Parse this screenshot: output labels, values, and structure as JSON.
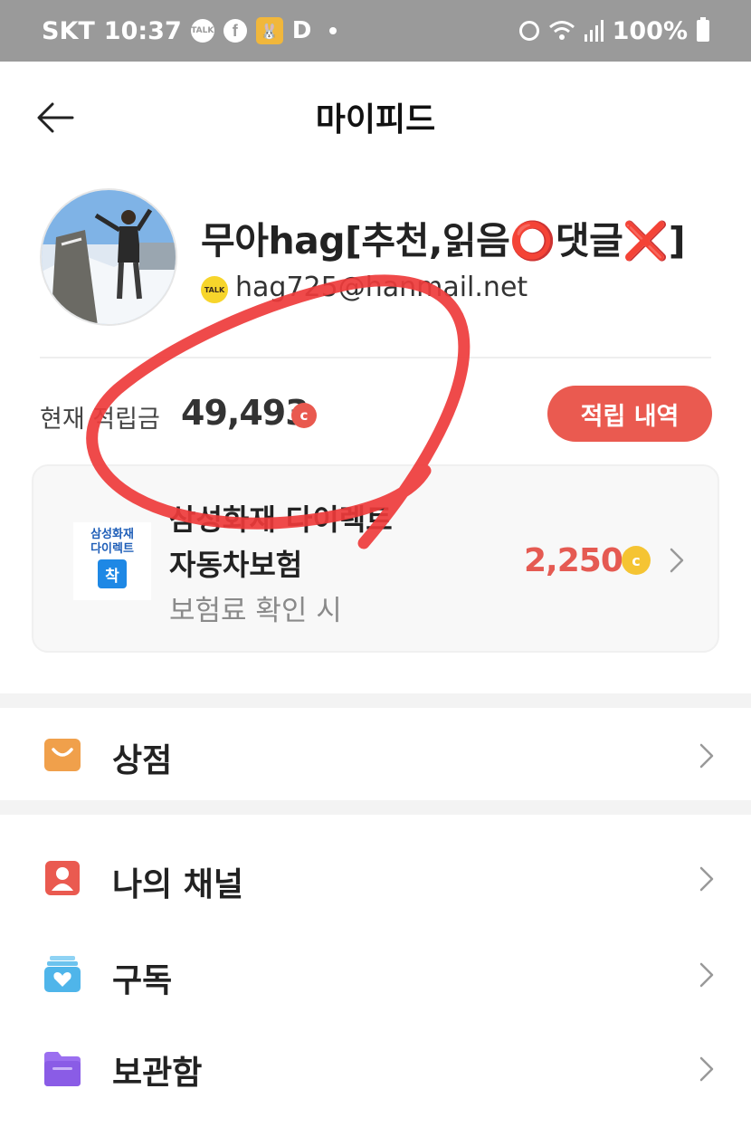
{
  "status_bar": {
    "carrier": "SKT",
    "time": "10:37",
    "talk_icon_text": "TALK",
    "facebook_icon": "f",
    "app_letter": "D",
    "battery": "100%",
    "icons": [
      "kakaotalk-icon",
      "facebook-icon",
      "app-icon",
      "alarm-icon",
      "wifi-icon",
      "signal-icon",
      "battery-icon"
    ]
  },
  "header": {
    "title": "마이피드",
    "back_icon": "back-arrow-icon"
  },
  "profile": {
    "name": "무아hag[추천,읽음⭕댓글❌]",
    "talk_badge": "TALK",
    "email": "hag725@hanmail.net"
  },
  "points": {
    "label": "현재 적립금",
    "value": "49,493",
    "coin_symbol": "c",
    "history_button": "적립 내역"
  },
  "ad": {
    "logo_line1": "삼성화재",
    "logo_line2": "다이렉트",
    "logo_mark": "착",
    "title_line1": "삼성화재 다이렉트",
    "title_line2": "자동차보험",
    "subtitle": "보험료 확인 시",
    "amount": "2,250",
    "coin_symbol": "c"
  },
  "menu": {
    "store": {
      "label": "상점",
      "icon": "shopping-bag-icon"
    },
    "my_channel": {
      "label": "나의 채널",
      "icon": "person-icon"
    },
    "subscribe": {
      "label": "구독",
      "icon": "heart-stack-icon"
    },
    "storage": {
      "label": "보관함",
      "icon": "folder-icon"
    }
  },
  "colors": {
    "accent_red": "#ea5a50",
    "coin_gold": "#f5c433",
    "status_bar": "#9a9a9a",
    "annotation_red": "#ee3b3b"
  }
}
